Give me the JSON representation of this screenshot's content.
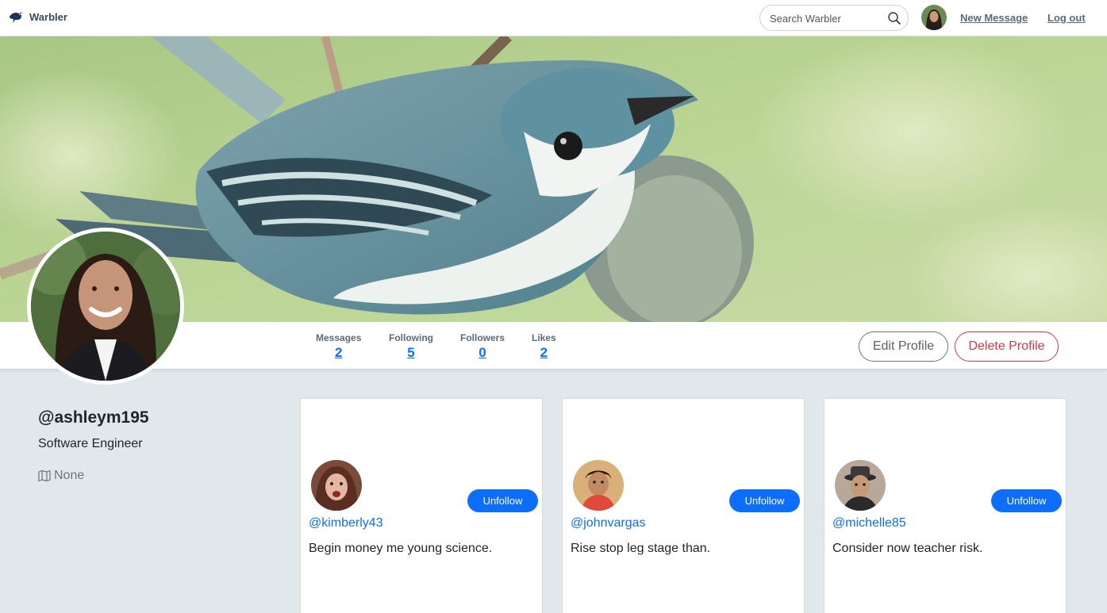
{
  "navbar": {
    "brand": "Warbler",
    "search_placeholder": "Search Warbler",
    "new_message": "New Message",
    "logout": "Log out"
  },
  "stats": [
    {
      "label": "Messages",
      "value": "2"
    },
    {
      "label": "Following",
      "value": "5"
    },
    {
      "label": "Followers",
      "value": "0"
    },
    {
      "label": "Likes",
      "value": "2"
    }
  ],
  "actions": {
    "edit_profile": "Edit Profile",
    "delete_profile": "Delete Profile"
  },
  "profile": {
    "username": "@ashleym195",
    "bio": "Software Engineer",
    "location": "None"
  },
  "following": [
    {
      "username": "@kimberly43",
      "bio": "Begin money me young science.",
      "button": "Unfollow"
    },
    {
      "username": "@johnvargas",
      "bio": "Rise stop leg stage than.",
      "button": "Unfollow"
    },
    {
      "username": "@michelle85",
      "bio": "Consider now teacher risk.",
      "button": "Unfollow"
    }
  ],
  "colors": {
    "primary": "#0d6efd",
    "danger": "#dc3545",
    "page_bg": "#e1e8ec"
  }
}
